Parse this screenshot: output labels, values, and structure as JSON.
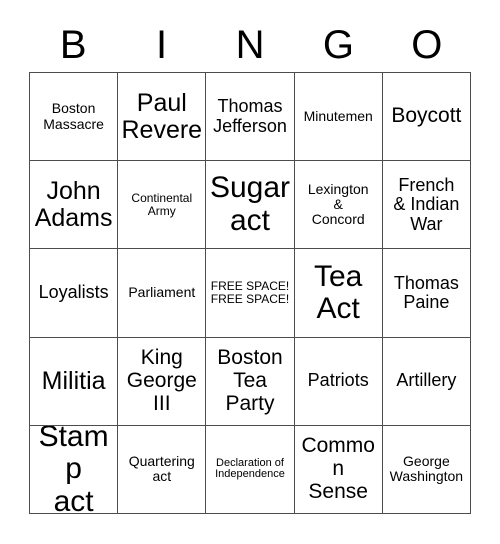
{
  "card": {
    "title": "BINGO",
    "header_letters": [
      "B",
      "I",
      "N",
      "G",
      "O"
    ],
    "free_space_index": 12,
    "colors": {
      "background": "#ffffff",
      "text": "#000000",
      "grid_line": "#4d4d4d"
    },
    "grid": {
      "rows": 5,
      "columns": 5,
      "cells": [
        {
          "text": "Boston\nMassacre",
          "size": "s"
        },
        {
          "text": "Paul\nRevere",
          "size": "xl"
        },
        {
          "text": "Thomas\nJefferson",
          "size": "m"
        },
        {
          "text": "Minutemen",
          "size": "s"
        },
        {
          "text": "Boycott",
          "size": "l"
        },
        {
          "text": "John\nAdams",
          "size": "xl"
        },
        {
          "text": "Continental\nArmy",
          "size": "xs"
        },
        {
          "text": "Sugar\nact",
          "size": "xxl"
        },
        {
          "text": "Lexington\n&\nConcord",
          "size": "s"
        },
        {
          "text": "French\n& Indian\nWar",
          "size": "m"
        },
        {
          "text": "Loyalists",
          "size": "m"
        },
        {
          "text": "Parliament",
          "size": "s"
        },
        {
          "text": "FREE SPACE! FREE SPACE!",
          "size": "xs"
        },
        {
          "text": "Tea\nAct",
          "size": "xxl"
        },
        {
          "text": "Thomas\nPaine",
          "size": "m"
        },
        {
          "text": "Militia",
          "size": "xl"
        },
        {
          "text": "King\nGeorge\nIII",
          "size": "l"
        },
        {
          "text": "Boston\nTea\nParty",
          "size": "l"
        },
        {
          "text": "Patriots",
          "size": "m"
        },
        {
          "text": "Artillery",
          "size": "m"
        },
        {
          "text": "Stamp\nact",
          "size": "xxl"
        },
        {
          "text": "Quartering\nact",
          "size": "s"
        },
        {
          "text": "Declaration of\nIndependence",
          "size": "xxs"
        },
        {
          "text": "Common\nSense",
          "size": "l"
        },
        {
          "text": "George\nWashington",
          "size": "s"
        }
      ]
    }
  }
}
